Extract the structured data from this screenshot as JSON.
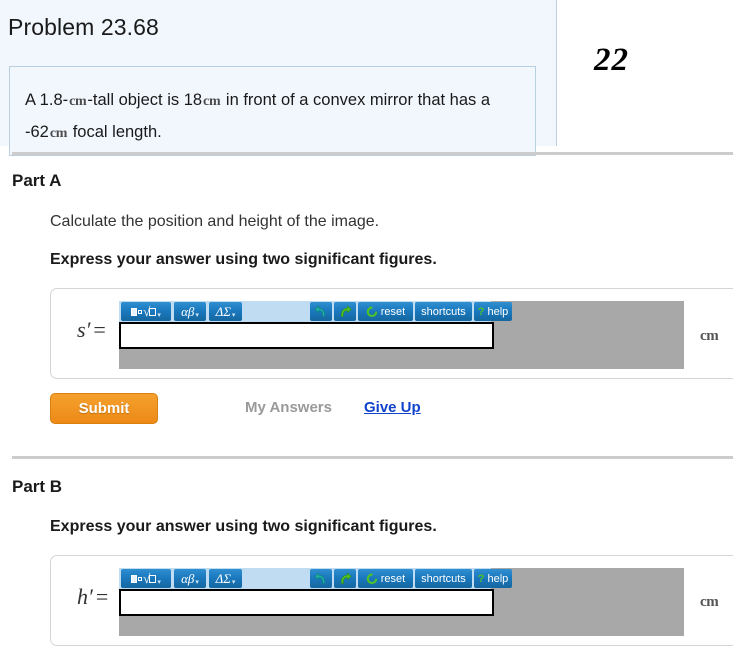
{
  "header": {
    "problem_title": "Problem 23.68",
    "problem_statement": {
      "seg1": "A 1.8-",
      "unit1": "cm",
      "seg2": "-tall object is 18",
      "unit2": "cm",
      "seg3": " in front of a convex mirror that has a -62",
      "unit3": "cm",
      "seg4": " focal length."
    },
    "page_badge": "22"
  },
  "parts": [
    {
      "heading": "Part A",
      "prompt": "Calculate the position and height of the image.",
      "emphasis": "Express your answer using two significant figures.",
      "variable": "s",
      "prime": "′",
      "equals": "=",
      "input_value": "",
      "unit": "cm"
    },
    {
      "heading": "Part B",
      "prompt": "",
      "emphasis": "Express your answer using two significant figures.",
      "variable": "h",
      "prime": "′",
      "equals": "=",
      "input_value": "",
      "unit": "cm"
    }
  ],
  "toolbar": {
    "sqrt_label": "template",
    "greek_label": "αβ",
    "delta_label": "ΔΣ",
    "caret": "▾",
    "undo_label": "undo",
    "redo_label": "redo",
    "reset_label": "reset",
    "shortcuts_label": "shortcuts",
    "help_label": "help",
    "help_mark": "?"
  },
  "actions": {
    "submit_label": "Submit",
    "my_answers_label": "My Answers",
    "give_up_label": "Give Up"
  },
  "colors": {
    "accent_orange": "#ef8f1c",
    "link_blue": "#1144cc",
    "toolbar_blue": "#1a78bd",
    "toolbar_bg": "#bfdcf2",
    "mathbox_gray": "#a8a8a8",
    "panel_bg": "#f2f7fd"
  }
}
